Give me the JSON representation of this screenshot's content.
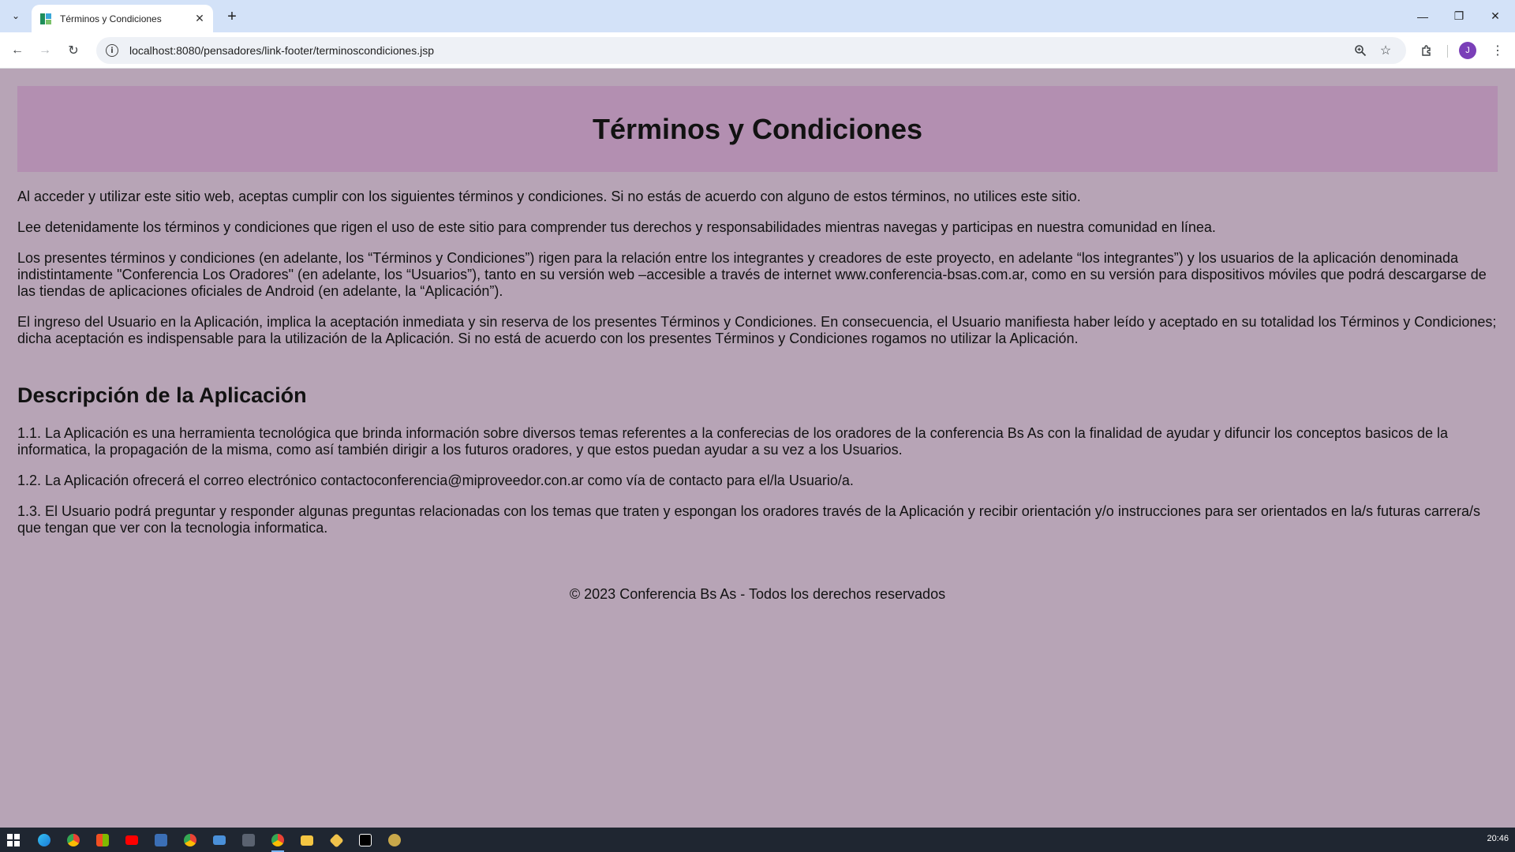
{
  "browser": {
    "tab_title": "Términos y Condiciones",
    "url": "localhost:8080/pensadores/link-footer/terminoscondiciones.jsp",
    "profile_initial": "J"
  },
  "page": {
    "title": "Términos y Condiciones",
    "paragraphs": [
      "Al acceder y utilizar este sitio web, aceptas cumplir con los siguientes términos y condiciones. Si no estás de acuerdo con alguno de estos términos, no utilices este sitio.",
      "Lee detenidamente los términos y condiciones que rigen el uso de este sitio para comprender tus derechos y responsabilidades mientras navegas y participas en nuestra comunidad en línea.",
      "Los presentes términos y condiciones (en adelante, los “Términos y Condiciones”) rigen para la relación entre los integrantes y creadores de este proyecto, en adelante “los integrantes”) y los usuarios de la aplicación denominada indistintamente \"Conferencia Los Oradores\" (en adelante, los “Usuarios”), tanto en su versión web –accesible a través de internet www.conferencia-bsas.com.ar, como en su versión para dispositivos móviles que podrá descargarse de las tiendas de aplicaciones oficiales de Android (en adelante, la “Aplicación”).",
      "El ingreso del Usuario en la Aplicación, implica la aceptación inmediata y sin reserva de los presentes Términos y Condiciones. En consecuencia, el Usuario manifiesta haber leído y aceptado en su totalidad los Términos y Condiciones; dicha aceptación es indispensable para la utilización de la Aplicación. Si no está de acuerdo con los presentes Términos y Condiciones rogamos no utilizar la Aplicación."
    ],
    "section_title": "Descripción de la Aplicación",
    "section_items": [
      "1.1. La Aplicación es una herramienta tecnológica que brinda información sobre diversos temas referentes a la conferecias de los oradores de la conferencia Bs As con la finalidad de ayudar y difuncir los conceptos basicos de la informatica, la propagación de la misma, como así también dirigir a los futuros oradores, y que estos puedan ayudar a su vez a los Usuarios.",
      "1.2. La Aplicación ofrecerá el correo electrónico contactoconferencia@miproveedor.con.ar como vía de contacto para el/la Usuario/a.",
      "1.3. El Usuario podrá preguntar y responder algunas preguntas relacionadas con los temas que traten y espongan los oradores través de la Aplicación y recibir orientación y/o instrucciones para ser orientados en la/s futuras carrera/s que tengan que ver con la tecnologia informatica."
    ],
    "footer": "© 2023 Conferencia Bs As - Todos los derechos reservados"
  },
  "taskbar": {
    "clock": "20:46"
  },
  "colors": {
    "page_bg": "#b7a4b6",
    "header_bg": "#b38fb1",
    "tabstrip_bg": "#d3e2f8",
    "taskbar_bg": "#1f2631"
  }
}
